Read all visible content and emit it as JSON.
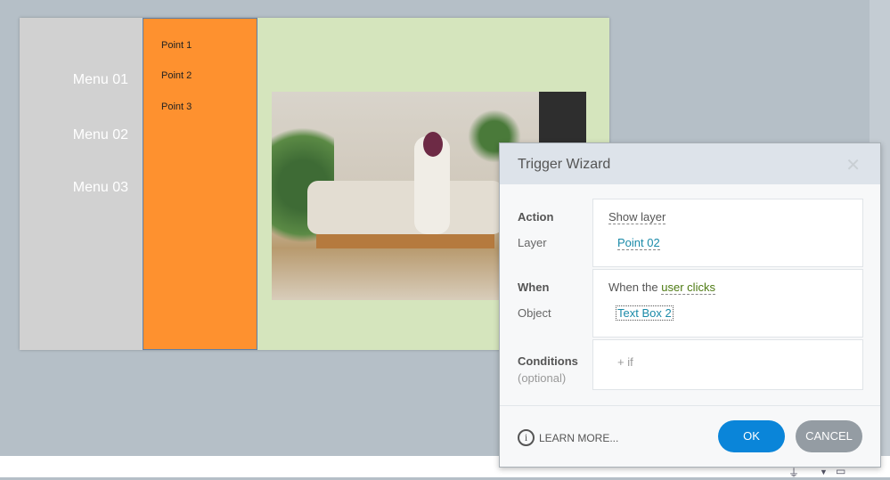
{
  "slide": {
    "menu": [
      "Menu 01",
      "Menu 02",
      "Menu 03"
    ],
    "points": [
      "Point 1",
      "Point 2",
      "Point 3"
    ]
  },
  "dialog": {
    "title": "Trigger Wizard",
    "action_label": "Action",
    "action_value": "Show layer",
    "layer_label": "Layer",
    "layer_value": "Point 02",
    "when_label": "When",
    "when_prefix": "When the",
    "when_value": "user clicks",
    "object_label": "Object",
    "object_value": "Text Box 2",
    "conditions_label": "Conditions",
    "conditions_sub": "(optional)",
    "add_condition": "+ if",
    "learn_more": "LEARN MORE...",
    "ok": "OK",
    "cancel": "CANCEL"
  },
  "colors": {
    "ok": "#0a85d9",
    "cancel": "#949ca3",
    "orange": "#fe912f",
    "green": "#d5e5bd"
  }
}
